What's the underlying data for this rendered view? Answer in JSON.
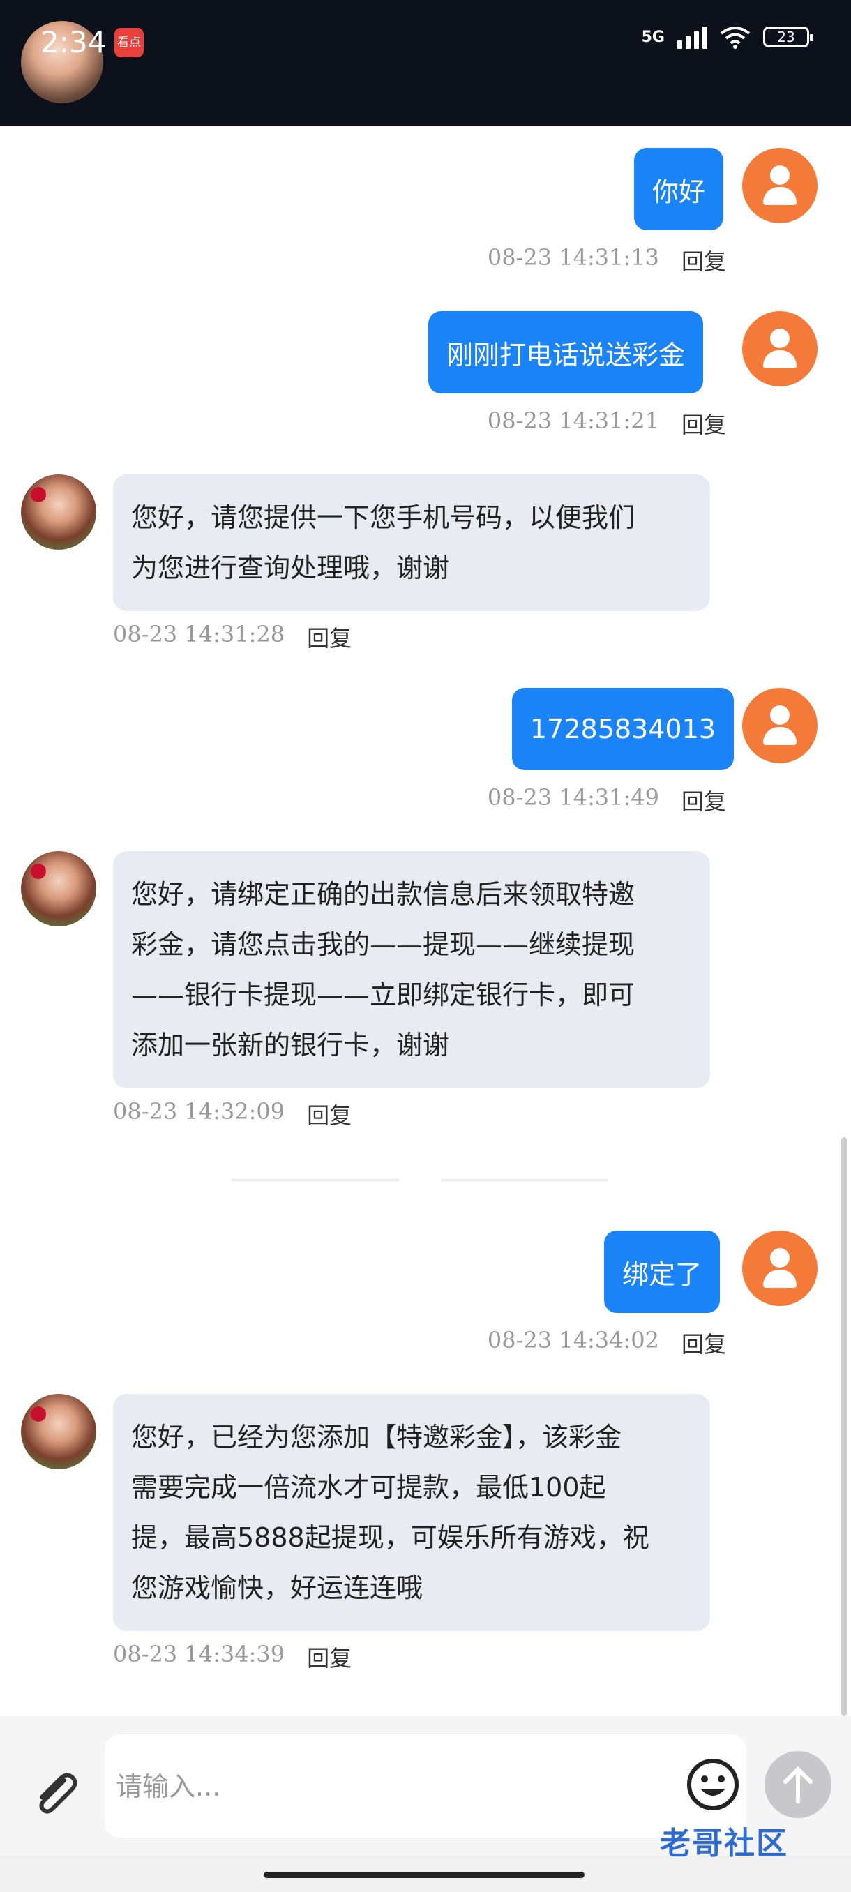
{
  "status_bar": {
    "time": "2:34",
    "app_badge": "看点",
    "network": "5G",
    "battery": "23"
  },
  "messages": [
    {
      "sender": "user",
      "text": "你好",
      "time": "08-23 14:31:13",
      "reply": "回复"
    },
    {
      "sender": "user",
      "text": "刚刚打电话说送彩金",
      "time": "08-23 14:31:21",
      "reply": "回复"
    },
    {
      "sender": "agent",
      "lines": [
        "您好，请您提供一下您手机号码，以便我们",
        "为您进行查询处理哦，谢谢"
      ],
      "time": "08-23 14:31:28",
      "reply": "回复"
    },
    {
      "sender": "user",
      "text": "17285834013",
      "time": "08-23 14:31:49",
      "reply": "回复"
    },
    {
      "sender": "agent",
      "lines": [
        "您好，请绑定正确的出款信息后来领取特邀",
        "彩金，请您点击我的——提现——继续提现",
        "——银行卡提现——立即绑定银行卡，即可",
        "添加一张新的银行卡，谢谢"
      ],
      "time": "08-23 14:32:09",
      "reply": "回复"
    },
    {
      "sender": "user",
      "text": "绑定了",
      "time": "08-23 14:34:02",
      "reply": "回复"
    },
    {
      "sender": "agent",
      "lines": [
        "您好，已经为您添加【特邀彩金】，该彩金",
        "需要完成一倍流水才可提款，最低100起",
        "提，最高5888起提现，可娱乐所有游戏，祝",
        "您游戏愉快，好运连连哦"
      ],
      "time": "08-23 14:34:39",
      "reply": "回复"
    }
  ],
  "input": {
    "placeholder": "请输入..."
  },
  "watermark": "老哥社区",
  "colors": {
    "user_bubble": "#1a83f5",
    "agent_bubble": "#e8ebf2",
    "user_avatar": "#f47a3a",
    "status_bar": "#0d111c"
  }
}
